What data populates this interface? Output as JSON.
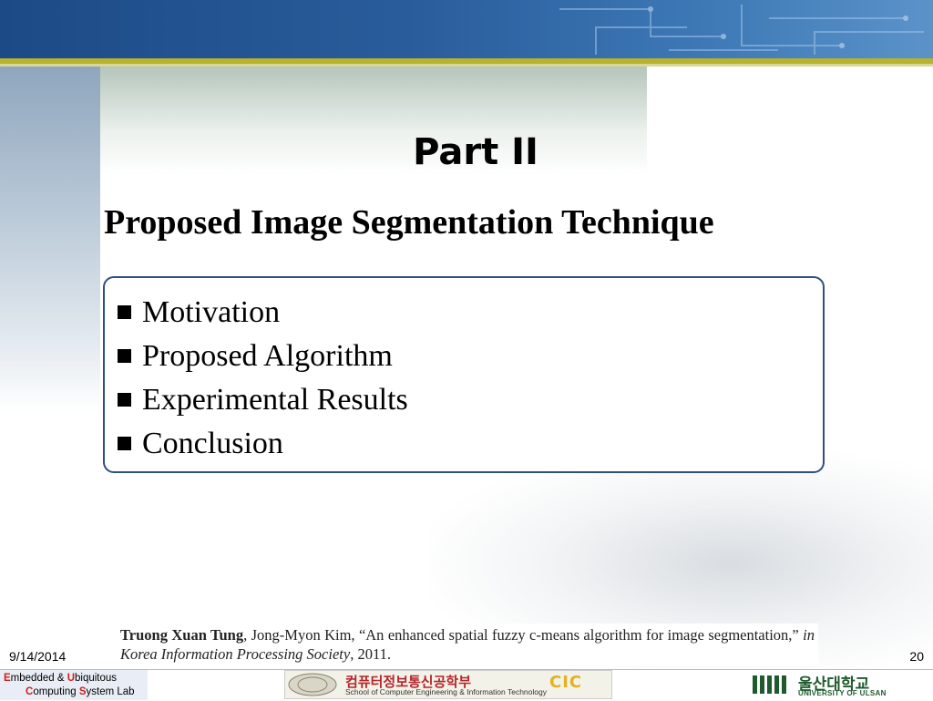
{
  "slide": {
    "part_title": "Part II",
    "subtitle": "Proposed Image Segmentation Technique"
  },
  "agenda": {
    "items": [
      {
        "label": "Motivation"
      },
      {
        "label": "Proposed Algorithm"
      },
      {
        "label": "Experimental Results"
      },
      {
        "label": "Conclusion"
      }
    ]
  },
  "citation": {
    "author": "Truong Xuan Tung",
    "coauthor": ", Jong-Myon Kim, “An enhanced spatial fuzzy c-means algorithm for image segmentation,” ",
    "venue": "in Korea Information Processing Society",
    "year": ", 2011."
  },
  "footer": {
    "date": "9/14/2014",
    "page_number": "20",
    "lab_logo": {
      "line1": [
        "E",
        "mbedded & ",
        "U",
        "biquitous"
      ],
      "line2": [
        "C",
        "omputing ",
        "S",
        "ystem Lab"
      ]
    },
    "school_logo": {
      "korean": "컴퓨터정보통신공학부",
      "english": "School of Computer Engineering & Information Technology",
      "mark": "CIC"
    },
    "university_logo": {
      "korean": "울산대학교",
      "english": "UNIVERSITY OF ULSAN"
    }
  },
  "colors": {
    "banner": "#1c4a86",
    "stripe": "#b8b32a",
    "box_border": "#2e4f80",
    "accent_red": "#d21d1d"
  }
}
